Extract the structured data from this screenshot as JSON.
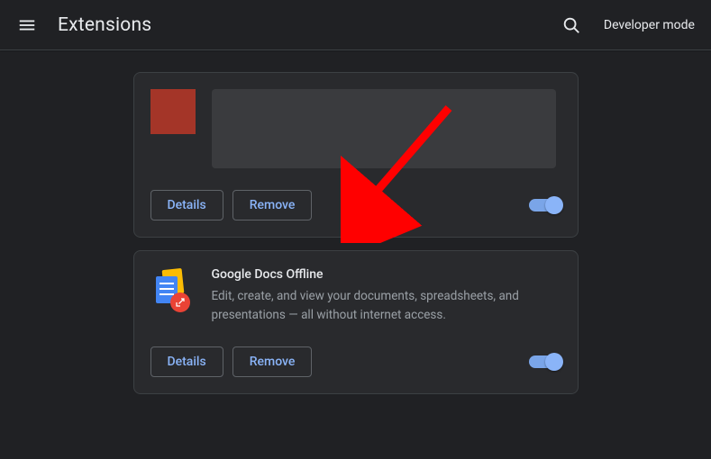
{
  "header": {
    "title": "Extensions",
    "devModeLabel": "Developer mode"
  },
  "extensions": [
    {
      "id": "ext1",
      "redacted": true,
      "detailsLabel": "Details",
      "removeLabel": "Remove",
      "enabled": true
    },
    {
      "id": "ext2",
      "title": "Google Docs Offline",
      "description": "Edit, create, and view your documents, spreadsheets, and presentations — all without internet access.",
      "detailsLabel": "Details",
      "removeLabel": "Remove",
      "enabled": true
    }
  ]
}
